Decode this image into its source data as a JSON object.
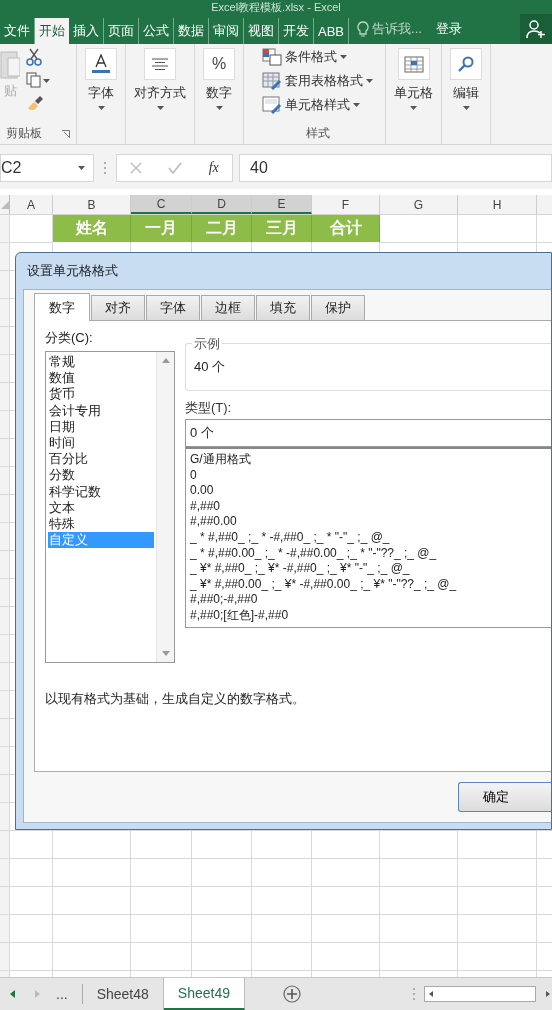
{
  "window": {
    "title": "Excel教程模板.xlsx - Excel"
  },
  "ribbon_tabs": [
    {
      "label": "文件",
      "selected": false
    },
    {
      "label": "开始",
      "selected": true
    },
    {
      "label": "插入",
      "selected": false
    },
    {
      "label": "页面",
      "selected": false
    },
    {
      "label": "公式",
      "selected": false
    },
    {
      "label": "数据",
      "selected": false
    },
    {
      "label": "审阅",
      "selected": false
    },
    {
      "label": "视图",
      "selected": false
    },
    {
      "label": "开发",
      "selected": false
    },
    {
      "label": "ABB",
      "selected": false
    }
  ],
  "tell_me": {
    "placeholder": "告诉我..."
  },
  "sign_in": "登录",
  "ribbon": {
    "clipboard": {
      "paste": "贴",
      "label": "剪贴板"
    },
    "big_buttons": [
      {
        "kind": "font",
        "label": "字体"
      },
      {
        "kind": "align",
        "label": "对齐方式"
      },
      {
        "kind": "number",
        "label": "数字",
        "glyph": "%"
      }
    ],
    "styles": {
      "items": [
        "条件格式",
        "套用表格格式",
        "单元格样式"
      ],
      "label": "样式"
    },
    "big_buttons_2": [
      {
        "kind": "cells",
        "label": "单元格"
      },
      {
        "kind": "edit",
        "label": "编辑"
      }
    ]
  },
  "formula_bar": {
    "name_box": "C2",
    "fx": "fx",
    "value": "40"
  },
  "grid": {
    "columns": [
      {
        "label": "A",
        "selected": false
      },
      {
        "label": "B",
        "selected": false
      },
      {
        "label": "C",
        "selected": true
      },
      {
        "label": "D",
        "selected": true
      },
      {
        "label": "E",
        "selected": true
      },
      {
        "label": "F",
        "selected": false
      },
      {
        "label": "G",
        "selected": false
      },
      {
        "label": "H",
        "selected": false
      }
    ],
    "header_row": [
      "姓名",
      "一月",
      "二月",
      "三月",
      "合计"
    ]
  },
  "dialog": {
    "title": "设置单元格格式",
    "tabs": [
      {
        "label": "数字",
        "selected": true
      },
      {
        "label": "对齐",
        "selected": false
      },
      {
        "label": "字体",
        "selected": false
      },
      {
        "label": "边框",
        "selected": false
      },
      {
        "label": "填充",
        "selected": false
      },
      {
        "label": "保护",
        "selected": false
      }
    ],
    "category_label": "分类(C):",
    "categories": [
      {
        "label": "常规",
        "selected": false
      },
      {
        "label": "数值",
        "selected": false
      },
      {
        "label": "货币",
        "selected": false
      },
      {
        "label": "会计专用",
        "selected": false
      },
      {
        "label": "日期",
        "selected": false
      },
      {
        "label": "时间",
        "selected": false
      },
      {
        "label": "百分比",
        "selected": false
      },
      {
        "label": "分数",
        "selected": false
      },
      {
        "label": "科学记数",
        "selected": false
      },
      {
        "label": "文本",
        "selected": false
      },
      {
        "label": "特殊",
        "selected": false
      },
      {
        "label": "自定义",
        "selected": true
      }
    ],
    "sample_label": "示例",
    "sample": "40 个",
    "type_label": "类型(T):",
    "type_value": "0 个",
    "formats": [
      "G/通用格式",
      "0",
      "0.00",
      "#,##0",
      "#,##0.00",
      "_ * #,##0_ ;_ * -#,##0_ ;_ * \"-\"_ ;_ @_",
      "_ * #,##0.00_ ;_ * -#,##0.00_ ;_ * \"-\"??_ ;_ @_",
      "_ ¥* #,##0_ ;_ ¥* -#,##0_ ;_ ¥* \"-\"_ ;_ @_",
      "_ ¥* #,##0.00_ ;_ ¥* -#,##0.00_ ;_ ¥* \"-\"??_ ;_ @_",
      "#,##0;-#,##0",
      "#,##0;[红色]-#,##0"
    ],
    "description": "以现有格式为基础，生成自定义的数字格式。",
    "ok": "确定"
  },
  "sheet_tabs": {
    "more": "...",
    "tabs": [
      {
        "label": "Sheet48",
        "selected": false
      },
      {
        "label": "Sheet49",
        "selected": true
      }
    ]
  }
}
